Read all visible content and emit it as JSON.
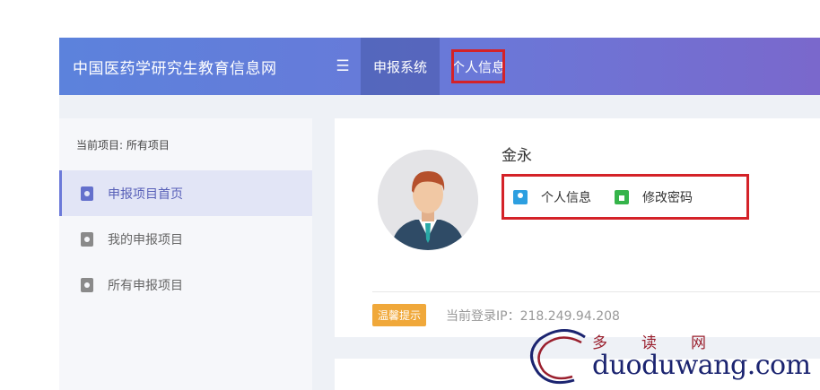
{
  "header": {
    "brand": "中国医药学研究生教育信息网",
    "menu_icon": "☰",
    "nav": [
      "申报系统",
      "个人信息"
    ]
  },
  "sidebar": {
    "title": "当前项目: 所有项目",
    "items": [
      {
        "label": "申报项目首页",
        "active": true
      },
      {
        "label": "我的申报项目",
        "active": false
      },
      {
        "label": "所有申报项目",
        "active": false
      }
    ]
  },
  "profile": {
    "name": "金永",
    "links": [
      {
        "label": "个人信息",
        "icon": "user-icon"
      },
      {
        "label": "修改密码",
        "icon": "lock-icon"
      }
    ],
    "tip_badge": "温馨提示",
    "login_ip": "当前登录IP：218.249.94.208"
  },
  "watermark": {
    "cn": "多读网",
    "en": "duoduwang.com"
  },
  "colors": {
    "highlight_border": "#d42228",
    "header_start": "#5c82dc",
    "header_end": "#7a68cc",
    "tip_badge": "#f0a83a"
  }
}
